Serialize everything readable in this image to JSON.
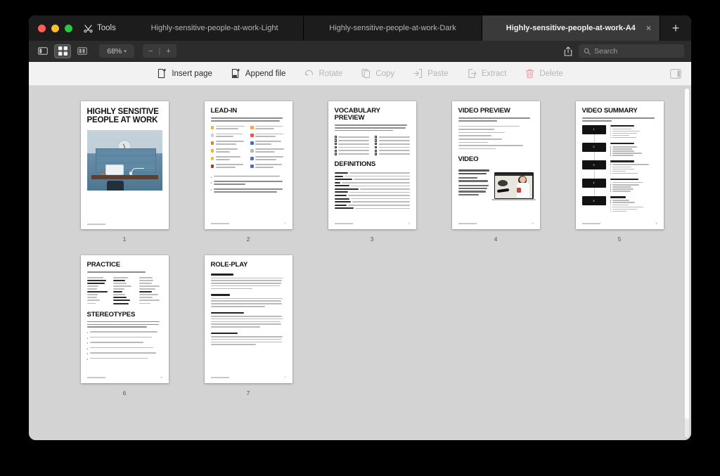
{
  "window": {
    "traffic_lights": [
      "close",
      "minimize",
      "maximize"
    ],
    "tools_label": "Tools"
  },
  "tabs": [
    {
      "label": "Highly-sensitive-people-at-work-Light",
      "active": false,
      "closable": false
    },
    {
      "label": "Highly-sensitive-people-at-work-Dark",
      "active": false,
      "closable": false
    },
    {
      "label": "Highly-sensitive-people-at-work-A4",
      "active": true,
      "closable": true,
      "close_glyph": "×"
    }
  ],
  "new_tab_glyph": "+",
  "toolbar": {
    "sidebar_toggle": "sidebar-toggle-icon",
    "thumbnail_view": "thumbnail-grid-icon",
    "split_view": "split-view-icon",
    "zoom_value": "68%",
    "zoom_chevron": "▾",
    "zoom_out": "−",
    "zoom_divider": "|",
    "zoom_in": "+",
    "share": "share-icon",
    "search_placeholder": "Search",
    "search_value": ""
  },
  "actions": [
    {
      "label": "Insert page",
      "icon": "insert-page-icon",
      "enabled": true
    },
    {
      "label": "Append file",
      "icon": "append-file-icon",
      "enabled": true
    },
    {
      "label": "Rotate",
      "icon": "rotate-icon",
      "enabled": false
    },
    {
      "label": "Copy",
      "icon": "copy-icon",
      "enabled": false
    },
    {
      "label": "Paste",
      "icon": "paste-icon",
      "enabled": false
    },
    {
      "label": "Extract",
      "icon": "extract-icon",
      "enabled": false
    },
    {
      "label": "Delete",
      "icon": "trash-icon",
      "enabled": false,
      "danger": true
    }
  ],
  "panel_toggle": "right-panel-toggle-icon",
  "pages": [
    {
      "number": "1",
      "kind": "cover",
      "title": "HIGHLY SENSITIVE PEOPLE AT WORK",
      "footer_page": ""
    },
    {
      "number": "2",
      "kind": "leadin",
      "title": "LEAD-IN",
      "footer_page": "2"
    },
    {
      "number": "3",
      "kind": "vocab",
      "title": "VOCABULARY PREVIEW",
      "title2": "DEFINITIONS",
      "footer_page": "3"
    },
    {
      "number": "4",
      "kind": "video",
      "title": "VIDEO PREVIEW",
      "title2": "VIDEO",
      "footer_page": "4"
    },
    {
      "number": "5",
      "kind": "summary",
      "title": "VIDEO SUMMARY",
      "footer_page": "5"
    },
    {
      "number": "6",
      "kind": "practice",
      "title": "PRACTICE",
      "title2": "STEREOTYPES",
      "footer_page": "6"
    },
    {
      "number": "7",
      "kind": "roleplay",
      "title": "ROLE-PLAY",
      "footer_page": "7"
    }
  ],
  "summary_badges": [
    "1",
    "2",
    "3",
    "4",
    "5"
  ],
  "colors": {
    "window_bg": "#d3d3d3",
    "tabbar_bg": "#1c1c1c",
    "toolbar_bg": "#2c2c2c",
    "actionbar_bg": "#f2f2f2",
    "active_tab_bg": "#3a3a3a",
    "traffic_red": "#ff5f57",
    "traffic_yellow": "#febc2e",
    "traffic_green": "#28c840",
    "delete_accent": "#e8a0a0"
  },
  "scroll": {
    "orientation": "vertical",
    "position": "top"
  }
}
